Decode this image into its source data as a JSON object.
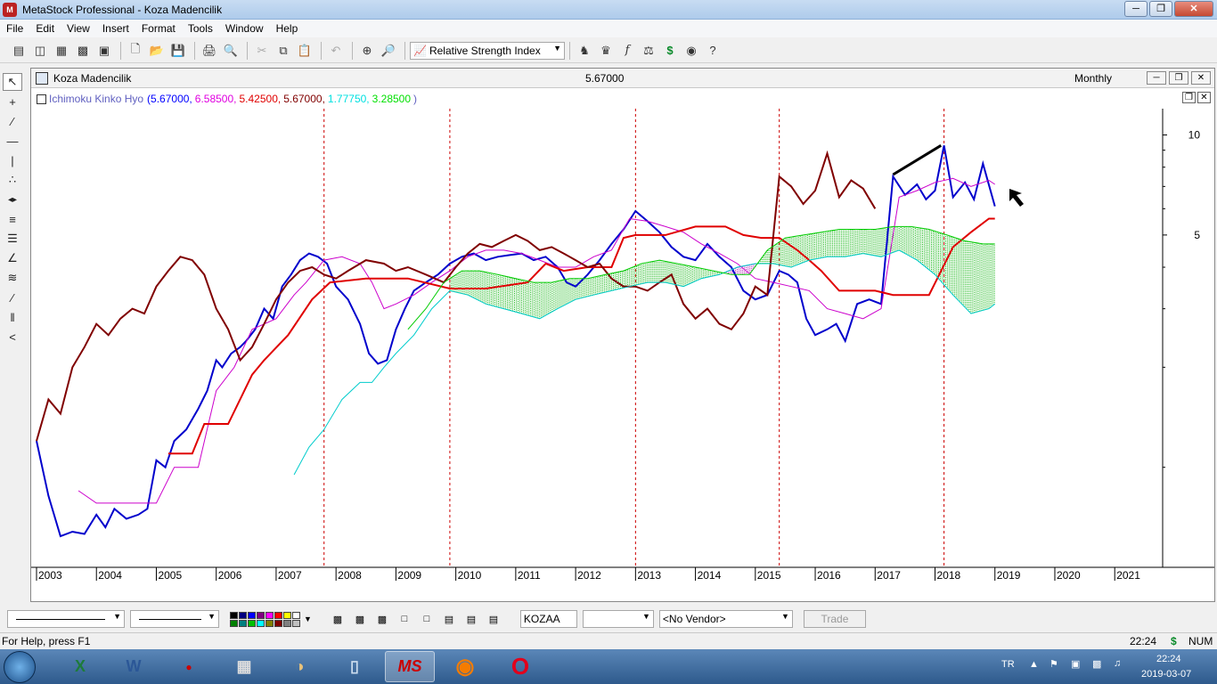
{
  "app": {
    "title": "MetaStock Professional - Koza Madencilik",
    "logo_text": "M"
  },
  "menu": [
    "File",
    "Edit",
    "View",
    "Insert",
    "Format",
    "Tools",
    "Window",
    "Help"
  ],
  "toolbar": {
    "indicator_select": "Relative Strength Index"
  },
  "chart_window": {
    "security": "Koza Madencilik",
    "price": "5.67000",
    "period": "Monthly",
    "indicator_name": "Ichimoku Kinko Hyo",
    "indicator_values": [
      {
        "text": "(5.67000,",
        "color": "#0000ff"
      },
      {
        "text": "6.58500,",
        "color": "#e000e0"
      },
      {
        "text": "5.42500,",
        "color": "#e00000"
      },
      {
        "text": "5.67000,",
        "color": "#800000"
      },
      {
        "text": "1.77750,",
        "color": "#00e0e0"
      },
      {
        "text": "3.28500",
        "color": "#00e000"
      },
      {
        "text": ")",
        "color": "#6060c0"
      }
    ]
  },
  "chart_data": {
    "type": "line",
    "title": "Ichimoku Kinko Hyo",
    "xlabel": "",
    "ylabel": "",
    "scale": "log",
    "ylim": [
      0.5,
      12
    ],
    "y_ticks": [
      10,
      5
    ],
    "x_ticks": [
      "2003",
      "2004",
      "2005",
      "2006",
      "2007",
      "2008",
      "2009",
      "2010",
      "2011",
      "2012",
      "2013",
      "2014",
      "2015",
      "2016",
      "2017",
      "2018",
      "2019",
      "2020",
      "2021"
    ],
    "vertical_markers": [
      2007.8,
      2009.9,
      2013.0,
      2015.4,
      2018.15
    ],
    "trendline": [
      [
        2017.3,
        7.6
      ],
      [
        2018.1,
        9.3
      ]
    ],
    "series": [
      {
        "color": "#0000cc",
        "x": [
          2003.0,
          2003.2,
          2003.4,
          2003.6,
          2003.8,
          2004.0,
          2004.15,
          2004.3,
          2004.5,
          2004.7,
          2004.85,
          2005.0,
          2005.15,
          2005.3,
          2005.5,
          2005.7,
          2005.85,
          2006.0,
          2006.1,
          2006.25,
          2006.4,
          2006.5,
          2006.65,
          2006.8,
          2006.95,
          2007.1,
          2007.25,
          2007.4,
          2007.55,
          2007.7,
          2007.85,
          2008.0,
          2008.2,
          2008.4,
          2008.55,
          2008.7,
          2008.85,
          2009.0,
          2009.15,
          2009.3,
          2009.5,
          2009.7,
          2009.9,
          2010.1,
          2010.3,
          2010.5,
          2010.7,
          2010.9,
          2011.1,
          2011.3,
          2011.5,
          2011.7,
          2011.85,
          2012.0,
          2012.2,
          2012.4,
          2012.6,
          2012.8,
          2013.0,
          2013.2,
          2013.4,
          2013.6,
          2013.8,
          2014.0,
          2014.2,
          2014.4,
          2014.6,
          2014.8,
          2015.0,
          2015.2,
          2015.4,
          2015.55,
          2015.7,
          2015.85,
          2016.0,
          2016.2,
          2016.35,
          2016.5,
          2016.7,
          2016.9,
          2017.1,
          2017.3,
          2017.5,
          2017.7,
          2017.85,
          2018.0,
          2018.15,
          2018.3,
          2018.5,
          2018.65,
          2018.8,
          2019.0
        ],
        "values": [
          1.2,
          0.82,
          0.62,
          0.64,
          0.63,
          0.72,
          0.66,
          0.75,
          0.7,
          0.72,
          0.75,
          1.05,
          1.0,
          1.2,
          1.3,
          1.5,
          1.7,
          2.1,
          2.0,
          2.2,
          2.3,
          2.4,
          2.6,
          3.0,
          2.8,
          3.5,
          3.8,
          4.2,
          4.4,
          4.3,
          4.1,
          3.5,
          3.2,
          2.7,
          2.2,
          2.05,
          2.1,
          2.6,
          3.0,
          3.4,
          3.6,
          3.8,
          4.1,
          4.3,
          4.4,
          4.2,
          4.3,
          4.35,
          4.4,
          4.2,
          4.3,
          4.0,
          3.6,
          3.5,
          3.8,
          4.2,
          4.7,
          5.2,
          5.9,
          5.5,
          5.1,
          4.6,
          4.3,
          4.2,
          4.7,
          4.3,
          4.0,
          3.4,
          3.2,
          3.3,
          3.9,
          3.8,
          3.6,
          2.8,
          2.5,
          2.6,
          2.7,
          2.4,
          3.1,
          3.2,
          3.1,
          7.5,
          6.6,
          7.1,
          6.4,
          6.8,
          9.3,
          6.5,
          7.2,
          6.4,
          8.2,
          6.1
        ]
      },
      {
        "color": "#cc00cc",
        "x": [
          2003.7,
          2004.0,
          2004.3,
          2004.7,
          2005.0,
          2005.3,
          2005.7,
          2006.0,
          2006.3,
          2006.6,
          2007.0,
          2007.3,
          2007.5,
          2007.8,
          2008.1,
          2008.4,
          2008.6,
          2008.8,
          2009.0,
          2009.3,
          2009.6,
          2009.9,
          2010.2,
          2010.5,
          2010.8,
          2011.1,
          2011.4,
          2011.7,
          2012.0,
          2012.3,
          2012.6,
          2012.9,
          2013.2,
          2013.5,
          2013.8,
          2014.1,
          2014.4,
          2014.7,
          2015.0,
          2015.3,
          2015.6,
          2015.9,
          2016.2,
          2016.5,
          2016.8,
          2017.1,
          2017.4,
          2017.7,
          2018.0,
          2018.3,
          2018.6,
          2018.9,
          2019.0
        ],
        "values": [
          0.85,
          0.78,
          0.78,
          0.78,
          0.78,
          1.0,
          1.0,
          1.7,
          2.0,
          2.6,
          2.8,
          3.3,
          3.6,
          4.2,
          4.3,
          4.1,
          3.6,
          3.0,
          3.1,
          3.3,
          3.6,
          3.9,
          4.3,
          4.5,
          4.5,
          4.4,
          4.2,
          4.0,
          4.0,
          4.3,
          4.5,
          5.6,
          5.5,
          5.3,
          5.1,
          4.7,
          4.4,
          4.1,
          3.7,
          3.6,
          3.5,
          3.4,
          3.0,
          2.9,
          2.8,
          3.0,
          6.5,
          6.8,
          7.2,
          7.4,
          7.0,
          7.3,
          7.1
        ]
      },
      {
        "color": "#e00000",
        "x": [
          2005.2,
          2005.6,
          2005.8,
          2006.2,
          2006.6,
          2006.8,
          2007.2,
          2007.6,
          2007.9,
          2008.5,
          2009.2,
          2009.9,
          2010.5,
          2011.2,
          2011.5,
          2011.8,
          2012.2,
          2012.6,
          2012.8,
          2013.0,
          2013.5,
          2014.0,
          2014.5,
          2014.8,
          2015.1,
          2015.4,
          2015.7,
          2015.9,
          2016.1,
          2016.4,
          2016.7,
          2017.0,
          2017.3,
          2017.5,
          2017.9,
          2018.3,
          2018.6,
          2018.9,
          2019.0
        ],
        "values": [
          1.1,
          1.1,
          1.35,
          1.35,
          1.9,
          2.1,
          2.5,
          3.2,
          3.6,
          3.7,
          3.7,
          3.45,
          3.45,
          3.6,
          4.1,
          3.9,
          4.0,
          4.0,
          4.9,
          5.0,
          5.0,
          5.3,
          5.3,
          5.0,
          4.9,
          4.9,
          4.5,
          4.2,
          3.9,
          3.4,
          3.4,
          3.4,
          3.3,
          3.3,
          3.3,
          4.6,
          5.1,
          5.6,
          5.6
        ]
      },
      {
        "color": "#800000",
        "x": [
          2003.0,
          2003.2,
          2003.4,
          2003.6,
          2003.8,
          2004.0,
          2004.2,
          2004.4,
          2004.6,
          2004.8,
          2005.0,
          2005.2,
          2005.4,
          2005.6,
          2005.8,
          2006.0,
          2006.2,
          2006.4,
          2006.6,
          2006.8,
          2007.0,
          2007.2,
          2007.4,
          2007.6,
          2007.8,
          2008.0,
          2008.2,
          2008.5,
          2008.8,
          2009.0,
          2009.2,
          2009.5,
          2009.8,
          2010.0,
          2010.2,
          2010.4,
          2010.6,
          2010.8,
          2011.0,
          2011.2,
          2011.4,
          2011.6,
          2011.8,
          2012.0,
          2012.2,
          2012.4,
          2012.6,
          2012.8,
          2013.0,
          2013.2,
          2013.4,
          2013.6,
          2013.8,
          2014.0,
          2014.2,
          2014.4,
          2014.6,
          2014.8,
          2015.0,
          2015.2,
          2015.4,
          2015.6,
          2015.8,
          2016.0,
          2016.2,
          2016.4,
          2016.6,
          2016.8,
          2017.0
        ],
        "values": [
          1.2,
          1.6,
          1.45,
          2.0,
          2.3,
          2.7,
          2.5,
          2.8,
          3.0,
          2.9,
          3.5,
          3.9,
          4.3,
          4.2,
          3.8,
          3.0,
          2.6,
          2.1,
          2.3,
          2.7,
          3.2,
          3.6,
          3.9,
          4.0,
          3.8,
          3.7,
          3.9,
          4.2,
          4.1,
          3.9,
          4.0,
          3.8,
          3.6,
          4.0,
          4.4,
          4.7,
          4.6,
          4.8,
          5.0,
          4.8,
          4.5,
          4.6,
          4.4,
          4.2,
          4.0,
          4.1,
          3.7,
          3.5,
          3.5,
          3.4,
          3.6,
          3.8,
          3.1,
          2.8,
          3.0,
          2.7,
          2.6,
          2.9,
          3.5,
          3.3,
          7.5,
          7.0,
          6.2,
          6.8,
          8.8,
          6.5,
          7.3,
          6.9,
          6.0
        ]
      },
      {
        "color": "#00cccc",
        "x": [
          2007.3,
          2007.55,
          2007.8,
          2008.1,
          2008.4,
          2008.6,
          2008.8,
          2009.0,
          2009.3,
          2009.6,
          2009.9,
          2010.2,
          2010.5,
          2010.8,
          2011.1,
          2011.4,
          2011.7,
          2012.0,
          2012.3,
          2012.6,
          2012.9,
          2013.2,
          2013.5,
          2013.8,
          2014.1,
          2014.4,
          2014.7,
          2015.0,
          2015.3,
          2015.6,
          2015.9,
          2016.2,
          2016.5,
          2016.8,
          2017.1,
          2017.4,
          2017.7,
          2018.0,
          2018.3,
          2018.6,
          2018.9,
          2019.0
        ],
        "values": [
          0.95,
          1.15,
          1.3,
          1.6,
          1.8,
          1.8,
          2.0,
          2.2,
          2.5,
          3.0,
          3.4,
          3.3,
          3.1,
          3.0,
          2.9,
          2.8,
          3.0,
          3.2,
          3.3,
          3.4,
          3.5,
          3.6,
          3.6,
          3.5,
          3.7,
          3.8,
          4.0,
          4.1,
          4.1,
          4.0,
          4.2,
          4.3,
          4.3,
          4.4,
          4.3,
          4.5,
          4.2,
          3.8,
          3.3,
          2.9,
          3.0,
          3.1
        ]
      },
      {
        "color": "#00cc00",
        "x": [
          2009.2,
          2009.5,
          2009.8,
          2010.1,
          2010.4,
          2010.7,
          2011.0,
          2011.3,
          2011.6,
          2011.9,
          2012.2,
          2012.5,
          2012.8,
          2013.1,
          2013.4,
          2013.7,
          2014.0,
          2014.3,
          2014.6,
          2014.9,
          2015.2,
          2015.5,
          2015.8,
          2016.1,
          2016.4,
          2016.7,
          2017.0,
          2017.3,
          2017.6,
          2017.9,
          2018.2,
          2018.5,
          2018.8,
          2019.0
        ],
        "values": [
          2.6,
          3.0,
          3.6,
          3.9,
          3.9,
          3.8,
          3.7,
          3.6,
          3.6,
          3.7,
          3.7,
          3.8,
          3.9,
          4.1,
          4.2,
          4.1,
          4.0,
          3.9,
          3.8,
          3.8,
          4.5,
          4.9,
          5.0,
          5.1,
          5.2,
          5.2,
          5.2,
          5.3,
          5.3,
          5.2,
          5.0,
          4.8,
          4.7,
          4.7
        ]
      }
    ]
  },
  "bottom": {
    "symbol": "KOZAA",
    "vendor": "<No Vendor>",
    "trade": "Trade",
    "swatch_colors": [
      "#000000",
      "#000080",
      "#0000ff",
      "#800080",
      "#ff00ff",
      "#ff0000",
      "#ffff00",
      "#ffffff",
      "#008000",
      "#008080",
      "#00c000",
      "#00ffff",
      "#808000",
      "#800000",
      "#808080",
      "#c0c0c0"
    ]
  },
  "status": {
    "help": "For Help, press F1",
    "time": "22:24",
    "dollar": "$",
    "num": "NUM"
  },
  "taskbar": {
    "ms_label": "MS",
    "lang": "TR",
    "clock_time": "22:24",
    "clock_date": "2019-03-07"
  }
}
